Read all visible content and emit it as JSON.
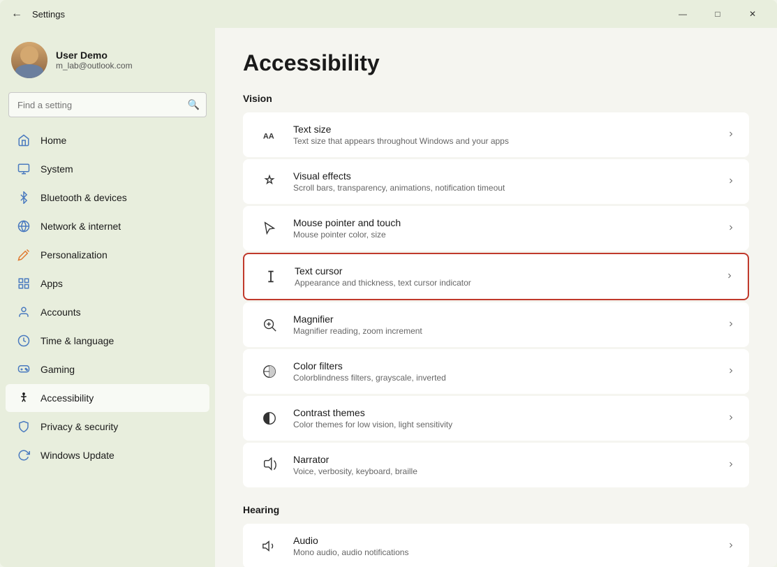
{
  "window": {
    "title": "Settings",
    "controls": {
      "minimize": "—",
      "maximize": "□",
      "close": "✕"
    }
  },
  "user": {
    "name": "User Demo",
    "email": "m_lab@outlook.com"
  },
  "search": {
    "placeholder": "Find a setting"
  },
  "nav": {
    "items": [
      {
        "id": "home",
        "label": "Home",
        "icon": "🏠"
      },
      {
        "id": "system",
        "label": "System",
        "icon": "💻"
      },
      {
        "id": "bluetooth",
        "label": "Bluetooth & devices",
        "icon": "🔵"
      },
      {
        "id": "network",
        "label": "Network & internet",
        "icon": "🌐"
      },
      {
        "id": "personalization",
        "label": "Personalization",
        "icon": "✏️"
      },
      {
        "id": "apps",
        "label": "Apps",
        "icon": "📱"
      },
      {
        "id": "accounts",
        "label": "Accounts",
        "icon": "👤"
      },
      {
        "id": "time",
        "label": "Time & language",
        "icon": "🕐"
      },
      {
        "id": "gaming",
        "label": "Gaming",
        "icon": "🎮"
      },
      {
        "id": "accessibility",
        "label": "Accessibility",
        "icon": "♿",
        "active": true
      },
      {
        "id": "privacy",
        "label": "Privacy & security",
        "icon": "🔒"
      },
      {
        "id": "update",
        "label": "Windows Update",
        "icon": "🔄"
      }
    ]
  },
  "page": {
    "title": "Accessibility",
    "sections": [
      {
        "id": "vision",
        "title": "Vision",
        "items": [
          {
            "id": "text-size",
            "title": "Text size",
            "subtitle": "Text size that appears throughout Windows and your apps",
            "icon": "AA"
          },
          {
            "id": "visual-effects",
            "title": "Visual effects",
            "subtitle": "Scroll bars, transparency, animations, notification timeout",
            "icon": "✦"
          },
          {
            "id": "mouse-pointer",
            "title": "Mouse pointer and touch",
            "subtitle": "Mouse pointer color, size",
            "icon": "↖"
          },
          {
            "id": "text-cursor",
            "title": "Text cursor",
            "subtitle": "Appearance and thickness, text cursor indicator",
            "icon": "Ab",
            "highlighted": true
          },
          {
            "id": "magnifier",
            "title": "Magnifier",
            "subtitle": "Magnifier reading, zoom increment",
            "icon": "🔍"
          },
          {
            "id": "color-filters",
            "title": "Color filters",
            "subtitle": "Colorblindness filters, grayscale, inverted",
            "icon": "◑"
          },
          {
            "id": "contrast-themes",
            "title": "Contrast themes",
            "subtitle": "Color themes for low vision, light sensitivity",
            "icon": "◐"
          },
          {
            "id": "narrator",
            "title": "Narrator",
            "subtitle": "Voice, verbosity, keyboard, braille",
            "icon": "🔊"
          }
        ]
      },
      {
        "id": "hearing",
        "title": "Hearing",
        "items": [
          {
            "id": "audio",
            "title": "Audio",
            "subtitle": "Mono audio, audio notifications",
            "icon": "🔈"
          }
        ]
      }
    ]
  }
}
